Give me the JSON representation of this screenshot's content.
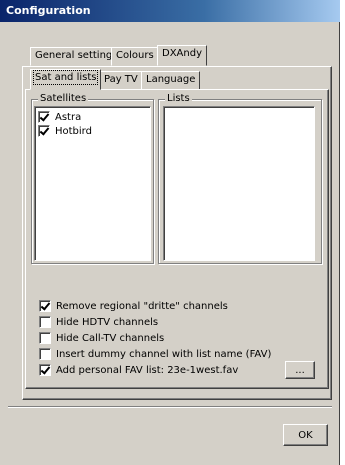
{
  "window": {
    "title": "Configuration"
  },
  "outer_tabs": [
    {
      "label": "General settings"
    },
    {
      "label": "Colours"
    },
    {
      "label": "DXAndy"
    }
  ],
  "inner_tabs": [
    {
      "label": "Sat and lists"
    },
    {
      "label": "Pay TV"
    },
    {
      "label": "Language"
    }
  ],
  "satellites": {
    "label": "Satellites",
    "items": [
      {
        "label": "Astra",
        "checked": true
      },
      {
        "label": "Hotbird",
        "checked": true
      }
    ]
  },
  "lists": {
    "label": "Lists"
  },
  "options": [
    {
      "label": "Remove regional \"dritte\" channels",
      "checked": true
    },
    {
      "label": "Hide HDTV channels",
      "checked": false
    },
    {
      "label": "Hide Call-TV channels",
      "checked": false
    },
    {
      "label": "Insert dummy channel with list name (FAV)",
      "checked": false
    },
    {
      "label": "Add personal FAV list: 23e-1west.fav",
      "checked": true
    }
  ],
  "buttons": {
    "browse": "...",
    "ok": "OK"
  }
}
